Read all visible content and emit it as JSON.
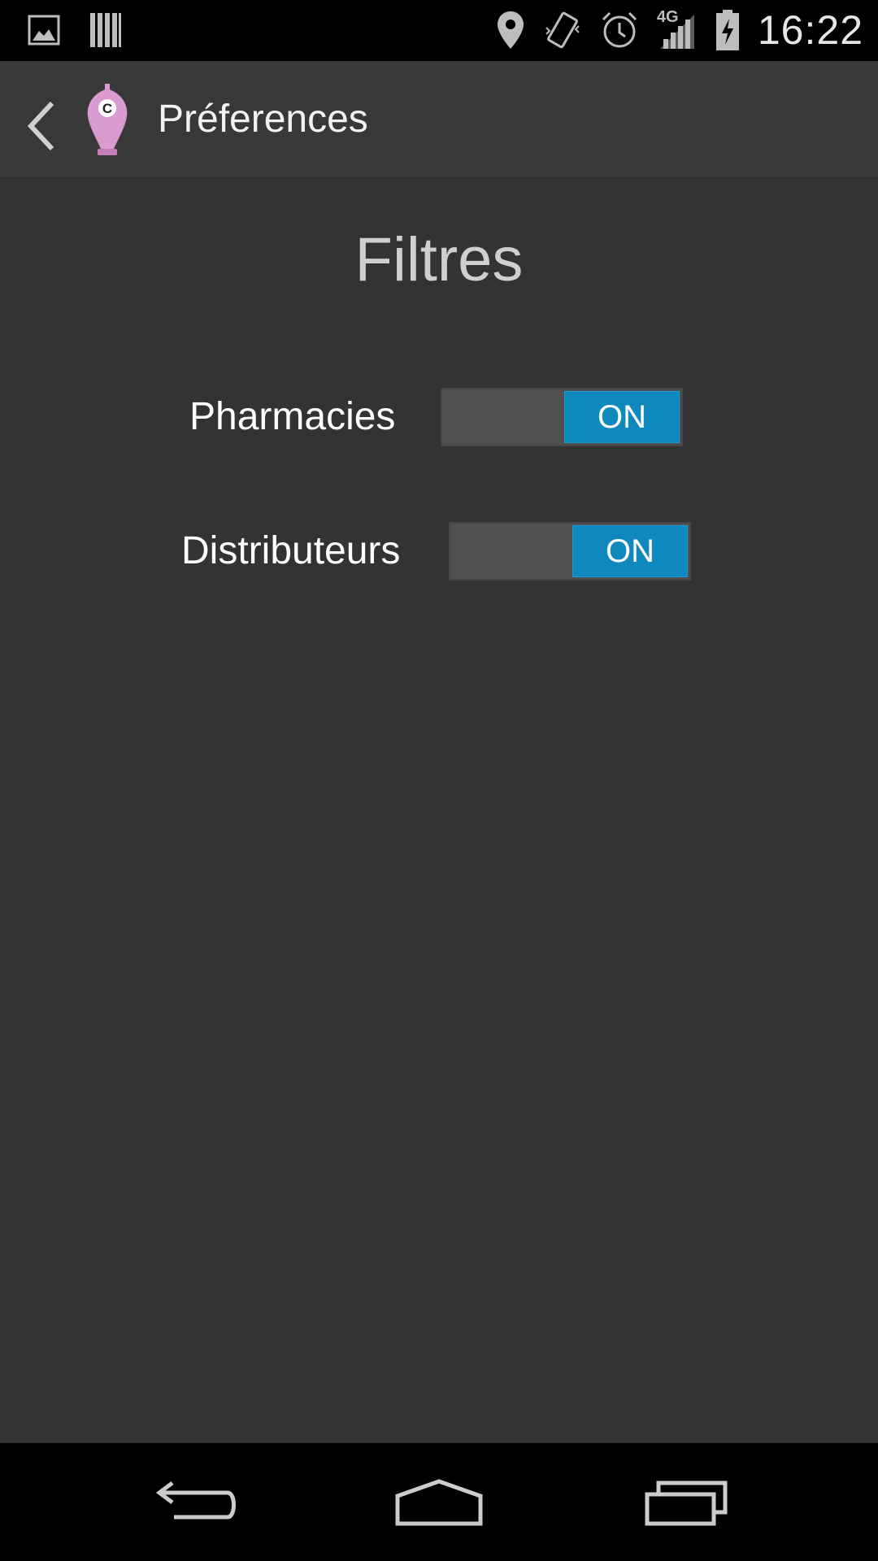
{
  "status_bar": {
    "time": "16:22",
    "network_label": "4G",
    "left_icons": [
      "gallery-icon",
      "barcode-icon"
    ],
    "right_icons": [
      "location-icon",
      "vibrate-icon",
      "alarm-icon",
      "signal-4g-icon",
      "battery-charging-icon"
    ]
  },
  "action_bar": {
    "title": "Préferences",
    "back_icon": "chevron-left-icon",
    "logo_icon": "app-logo-icon"
  },
  "content": {
    "section_title": "Filtres",
    "preferences": [
      {
        "label": "Pharmacies",
        "switch_label": "ON",
        "enabled": true
      },
      {
        "label": "Distributeurs",
        "switch_label": "ON",
        "enabled": true
      }
    ]
  },
  "nav_bar": {
    "buttons": [
      "back-nav-icon",
      "home-nav-icon",
      "recents-nav-icon"
    ]
  },
  "colors": {
    "background": "#333333",
    "action_bar": "#383838",
    "switch_on": "#0f88bd",
    "switch_track": "#505050",
    "logo_pink": "#d99bd0"
  }
}
